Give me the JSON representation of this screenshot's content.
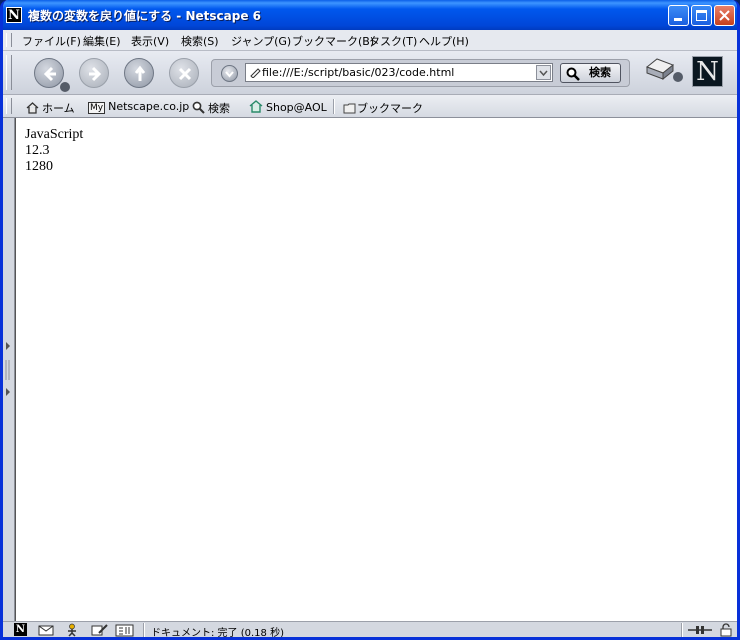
{
  "window": {
    "title": "複数の変数を戻り値にする - Netscape 6",
    "app_icon_letter": "N"
  },
  "menu": {
    "items": [
      "ファイル(F)",
      "編集(E)",
      "表示(V)",
      "検索(S)",
      "ジャンプ(G)",
      "ブックマーク(B)",
      "タスク(T)",
      "ヘルプ(H)"
    ]
  },
  "nav": {
    "url": "file:///E:/script/basic/023/code.html",
    "search_label": "検索",
    "logo_letter": "N"
  },
  "personal_toolbar": {
    "home": "ホーム",
    "my_badge": "My",
    "netscape": "Netscape.co.jp",
    "search": "検索",
    "shop": "Shop@AOL",
    "bookmarks": "ブックマーク"
  },
  "content": {
    "lines": [
      "JavaScript",
      "12.3",
      "1280"
    ]
  },
  "status": {
    "text": "ドキュメント: 完了 (0.18 秒)"
  },
  "colors": {
    "title_bar": "#0058ee",
    "window_border": "#0831d9",
    "chrome": "#d4d8e0"
  }
}
